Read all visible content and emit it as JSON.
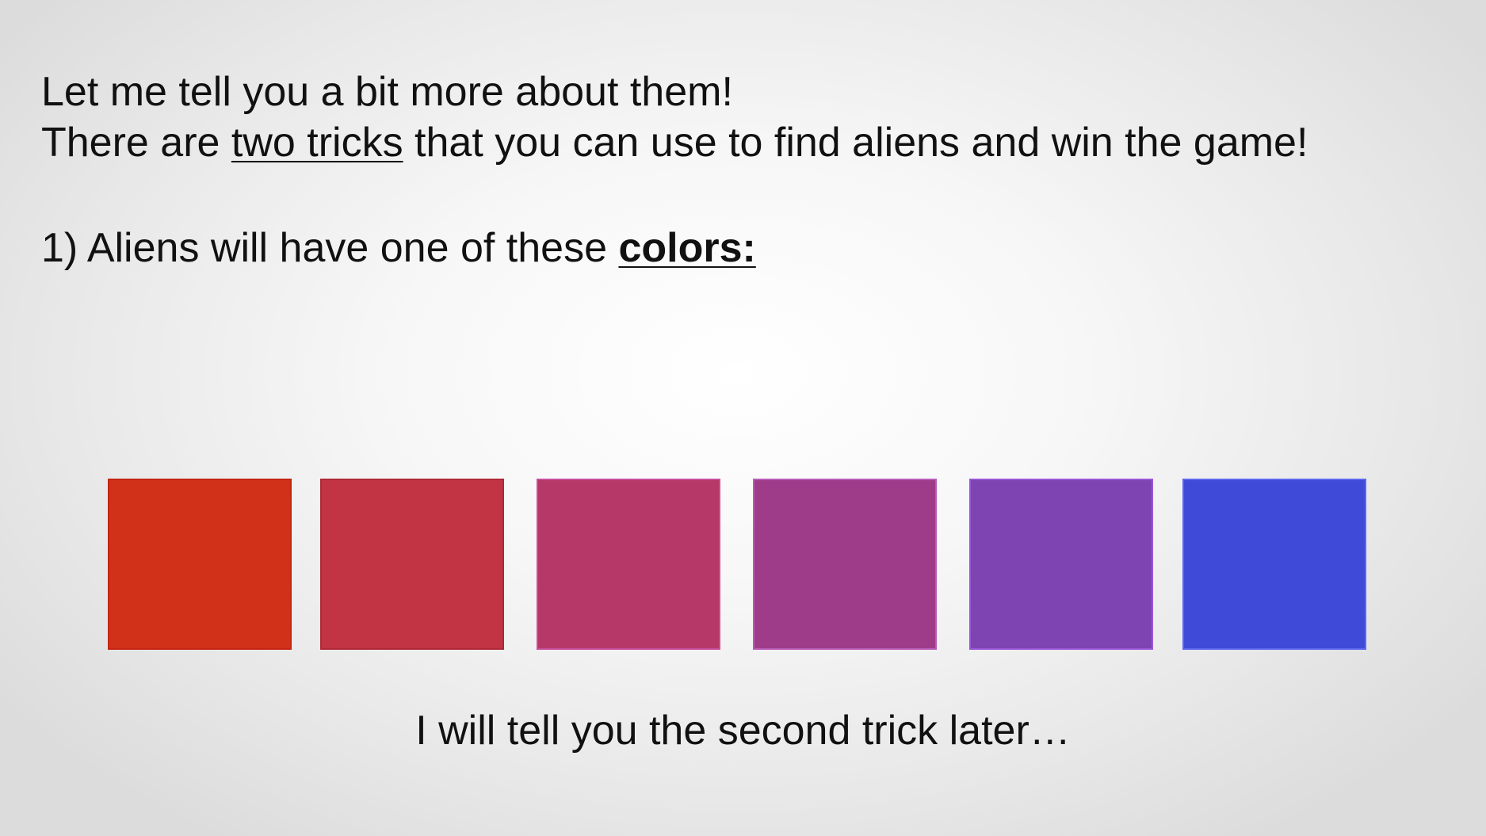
{
  "slide": {
    "line1": "Let me tell you a bit more about them!",
    "line2": {
      "before": "There are ",
      "emphasis": "two tricks",
      "after": " that you can use to find aliens and win the game!"
    },
    "line3": {
      "before": "1) Aliens will have one of these ",
      "emphasis": "colors:"
    },
    "caption": "I will tell you the second trick later…"
  },
  "colors": [
    {
      "fill": "#d23119",
      "border": "#c42512"
    },
    {
      "fill": "#c23444",
      "border": "#b02838"
    },
    {
      "fill": "#b53868",
      "border": "#c84c9c"
    },
    {
      "fill": "#9e3c89",
      "border": "#b85ab8"
    },
    {
      "fill": "#7e44b2",
      "border": "#9856d8"
    },
    {
      "fill": "#3f4bd8",
      "border": "#5a66f0"
    }
  ]
}
